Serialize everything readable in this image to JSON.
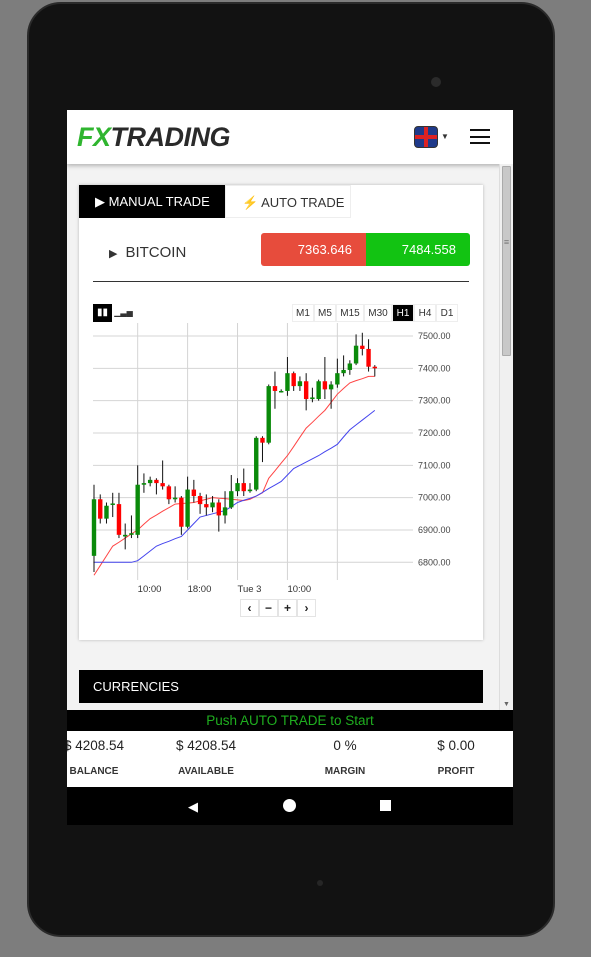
{
  "header": {
    "logo_fx": "FX",
    "logo_rest": "TRADING",
    "language_icon": "uk-flag-icon"
  },
  "tabs": [
    {
      "label": "MANUAL TRADE",
      "icon": "play-icon",
      "active": true
    },
    {
      "label": "AUTO TRADE",
      "icon": "bolt-icon",
      "active": false
    }
  ],
  "instrument": {
    "name": "BITCOIN",
    "bid": "7363.646",
    "ask": "7484.558",
    "bid_color": "#e74c3c",
    "ask_color": "#12c312"
  },
  "timeframes": [
    {
      "label": "M1"
    },
    {
      "label": "M5"
    },
    {
      "label": "M15"
    },
    {
      "label": "M30"
    },
    {
      "label": "H1",
      "active": true
    },
    {
      "label": "H4"
    },
    {
      "label": "D1"
    }
  ],
  "chart_nav": {
    "prev": "‹",
    "zoom_out": "−",
    "zoom_in": "+",
    "next": "›"
  },
  "chart_data": {
    "type": "candlestick",
    "ylim": [
      6750,
      7530
    ],
    "y_ticks": [
      "7500.00",
      "7400.00",
      "7300.00",
      "7200.00",
      "7100.00",
      "7000.00",
      "6900.00",
      "6800.00"
    ],
    "x_ticks": [
      {
        "label": "10:00",
        "candle": 8
      },
      {
        "label": "18:00",
        "candle": 16
      },
      {
        "label": "Tue 3",
        "candle": 24
      },
      {
        "label": "10:00",
        "candle": 32
      }
    ],
    "grid": true,
    "up_color": "#0a8a0a",
    "down_color": "#ff0000",
    "candles": [
      [
        6820,
        7040,
        6770,
        6995
      ],
      [
        6995,
        7010,
        6920,
        6935
      ],
      [
        6935,
        6985,
        6920,
        6975
      ],
      [
        6978,
        7015,
        6940,
        6982
      ],
      [
        6980,
        7015,
        6875,
        6885
      ],
      [
        6880,
        6920,
        6840,
        6885
      ],
      [
        6885,
        6945,
        6875,
        6890
      ],
      [
        6885,
        7100,
        6875,
        7040
      ],
      [
        7040,
        7075,
        7015,
        7045
      ],
      [
        7045,
        7065,
        7035,
        7055
      ],
      [
        7055,
        7060,
        7010,
        7045
      ],
      [
        7045,
        7115,
        7025,
        7035
      ],
      [
        7035,
        7040,
        6980,
        6995
      ],
      [
        6995,
        7035,
        6985,
        7000
      ],
      [
        7000,
        7005,
        6885,
        6910
      ],
      [
        6910,
        7065,
        6905,
        7025
      ],
      [
        7025,
        7055,
        6985,
        7005
      ],
      [
        7005,
        7015,
        6950,
        6980
      ],
      [
        6980,
        7010,
        6945,
        6970
      ],
      [
        6970,
        7005,
        6955,
        6985
      ],
      [
        6985,
        6995,
        6895,
        6945
      ],
      [
        6945,
        7020,
        6920,
        6970
      ],
      [
        6970,
        7070,
        6965,
        7020
      ],
      [
        7020,
        7060,
        7005,
        7045
      ],
      [
        7045,
        7090,
        7005,
        7020
      ],
      [
        7020,
        7045,
        7015,
        7025
      ],
      [
        7025,
        7190,
        7020,
        7185
      ],
      [
        7185,
        7190,
        7110,
        7170
      ],
      [
        7170,
        7350,
        7165,
        7345
      ],
      [
        7345,
        7390,
        7275,
        7330
      ],
      [
        7330,
        7335,
        7325,
        7330
      ],
      [
        7330,
        7435,
        7315,
        7385
      ],
      [
        7385,
        7390,
        7330,
        7345
      ],
      [
        7345,
        7375,
        7330,
        7360
      ],
      [
        7360,
        7385,
        7270,
        7305
      ],
      [
        7305,
        7340,
        7295,
        7310
      ],
      [
        7305,
        7365,
        7300,
        7360
      ],
      [
        7360,
        7435,
        7305,
        7335
      ],
      [
        7335,
        7360,
        7275,
        7350
      ],
      [
        7350,
        7430,
        7340,
        7385
      ],
      [
        7385,
        7440,
        7375,
        7395
      ],
      [
        7395,
        7425,
        7380,
        7415
      ],
      [
        7415,
        7505,
        7410,
        7470
      ],
      [
        7470,
        7510,
        7440,
        7460
      ],
      [
        7460,
        7490,
        7390,
        7405
      ],
      [
        7405,
        7410,
        7375,
        7400
      ]
    ],
    "candle_format": [
      "open",
      "high",
      "low",
      "close"
    ],
    "ma_red": [
      6760,
      6790,
      6820,
      6850,
      6862,
      6875,
      6888,
      6900,
      6918,
      6935,
      6946,
      6958,
      6969,
      6980,
      6982,
      6983,
      6985,
      6990,
      6995,
      7000,
      6998,
      6997,
      6995,
      6993,
      6991,
      6995,
      7005,
      7015,
      7060,
      7083,
      7107,
      7130,
      7158,
      7187,
      7215,
      7233,
      7252,
      7270,
      7295,
      7320,
      7338,
      7355,
      7362,
      7368,
      7375,
      7375
    ],
    "ma_blue": [
      6800,
      6800,
      6800,
      6800,
      6800,
      6800,
      6800,
      6805,
      6820,
      6835,
      6850,
      6858,
      6865,
      6873,
      6880,
      6900,
      6920,
      6940,
      6945,
      6950,
      6955,
      6960,
      6972,
      6985,
      6992,
      6998,
      7005,
      7016,
      7028,
      7039,
      7050,
      7070,
      7090,
      7100,
      7110,
      7120,
      7130,
      7142,
      7153,
      7165,
      7188,
      7210,
      7225,
      7240,
      7255,
      7270
    ],
    "ma_colors": [
      "#ff4444",
      "#4444ee"
    ]
  },
  "currencies": {
    "title": "CURRENCIES"
  },
  "status": {
    "message": "Push AUTO TRADE to Start"
  },
  "stats": [
    {
      "value": "$ 4208.54",
      "label": "BALANCE"
    },
    {
      "value": "$ 4208.54",
      "label": "AVAILABLE"
    },
    {
      "value": "0 %",
      "label": "MARGIN"
    },
    {
      "value": "$ 0.00",
      "label": "PROFIT"
    }
  ]
}
